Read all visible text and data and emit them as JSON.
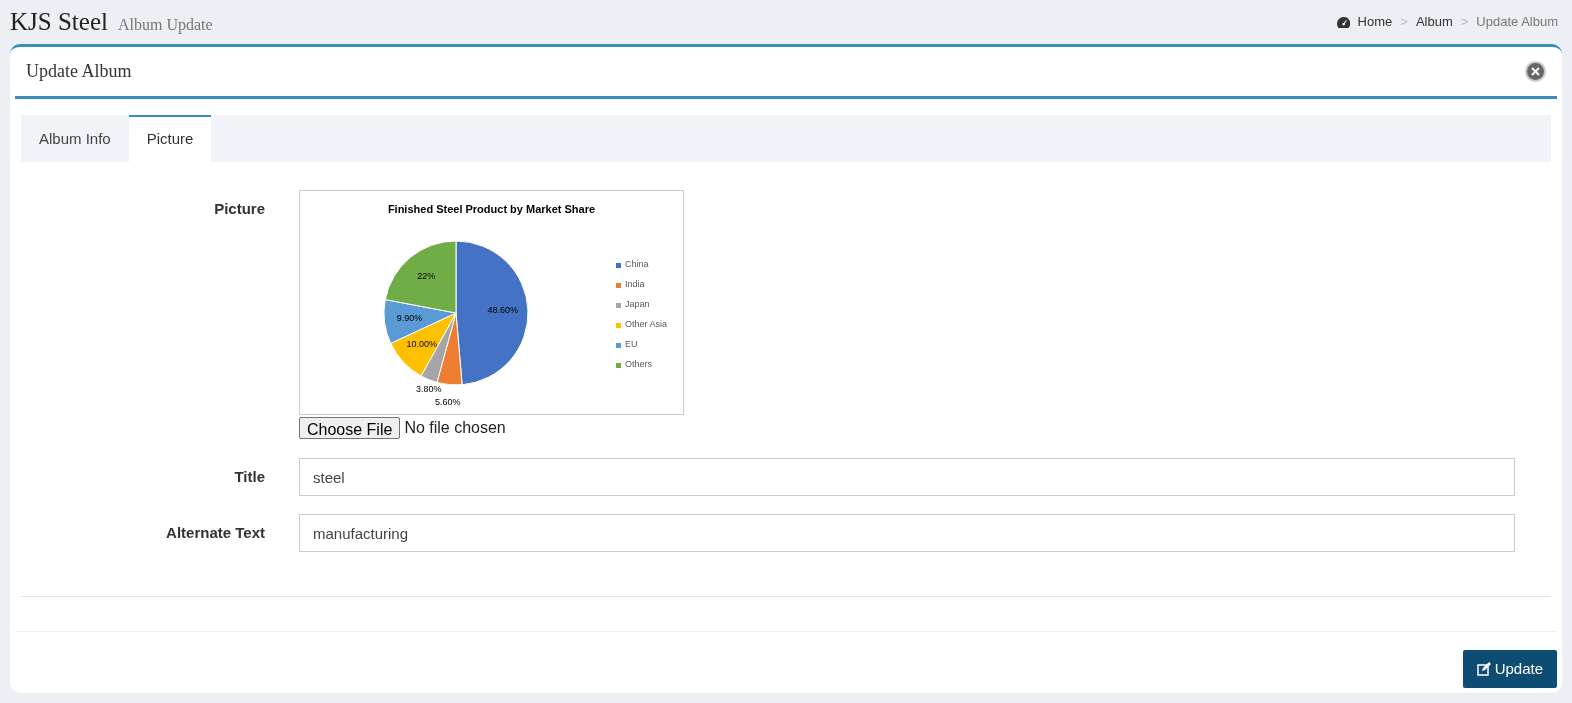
{
  "header": {
    "title": "KJS Steel",
    "subtitle": "Album Update",
    "breadcrumb": [
      {
        "label": "Home",
        "kind": "home"
      },
      {
        "label": "Album",
        "kind": "link"
      },
      {
        "label": "Update Album",
        "kind": "current"
      }
    ],
    "separator": ">"
  },
  "card": {
    "title": "Update Album"
  },
  "tabs": [
    {
      "label": "Album Info",
      "selected": false
    },
    {
      "label": "Picture",
      "selected": true
    }
  ],
  "picture": {
    "label": "Picture",
    "chart_data": {
      "type": "pie",
      "title": "Finished Steel Product  by Market Share",
      "categories": [
        "China",
        "India",
        "Japan",
        "Other Asia",
        "EU",
        "Others"
      ],
      "series": [
        {
          "values": [
            48.6,
            5.6,
            3.8,
            10.0,
            9.9,
            22
          ],
          "colors": [
            "#4472c4",
            "#ed7d31",
            "#a5a5a5",
            "#ffc000",
            "#5b9bd5",
            "#70ad47"
          ]
        }
      ],
      "legend": "right",
      "value_labels": [
        "48.60%",
        "5.60%",
        "3.80%",
        "10.00%",
        "9.90%",
        "22%"
      ]
    },
    "file_button": "Choose File",
    "file_status": "No file chosen"
  },
  "fields": [
    {
      "label": "Title",
      "value": "steel"
    },
    {
      "label": "Alternate Text",
      "value": "manufacturing"
    }
  ],
  "update_button": "Update"
}
